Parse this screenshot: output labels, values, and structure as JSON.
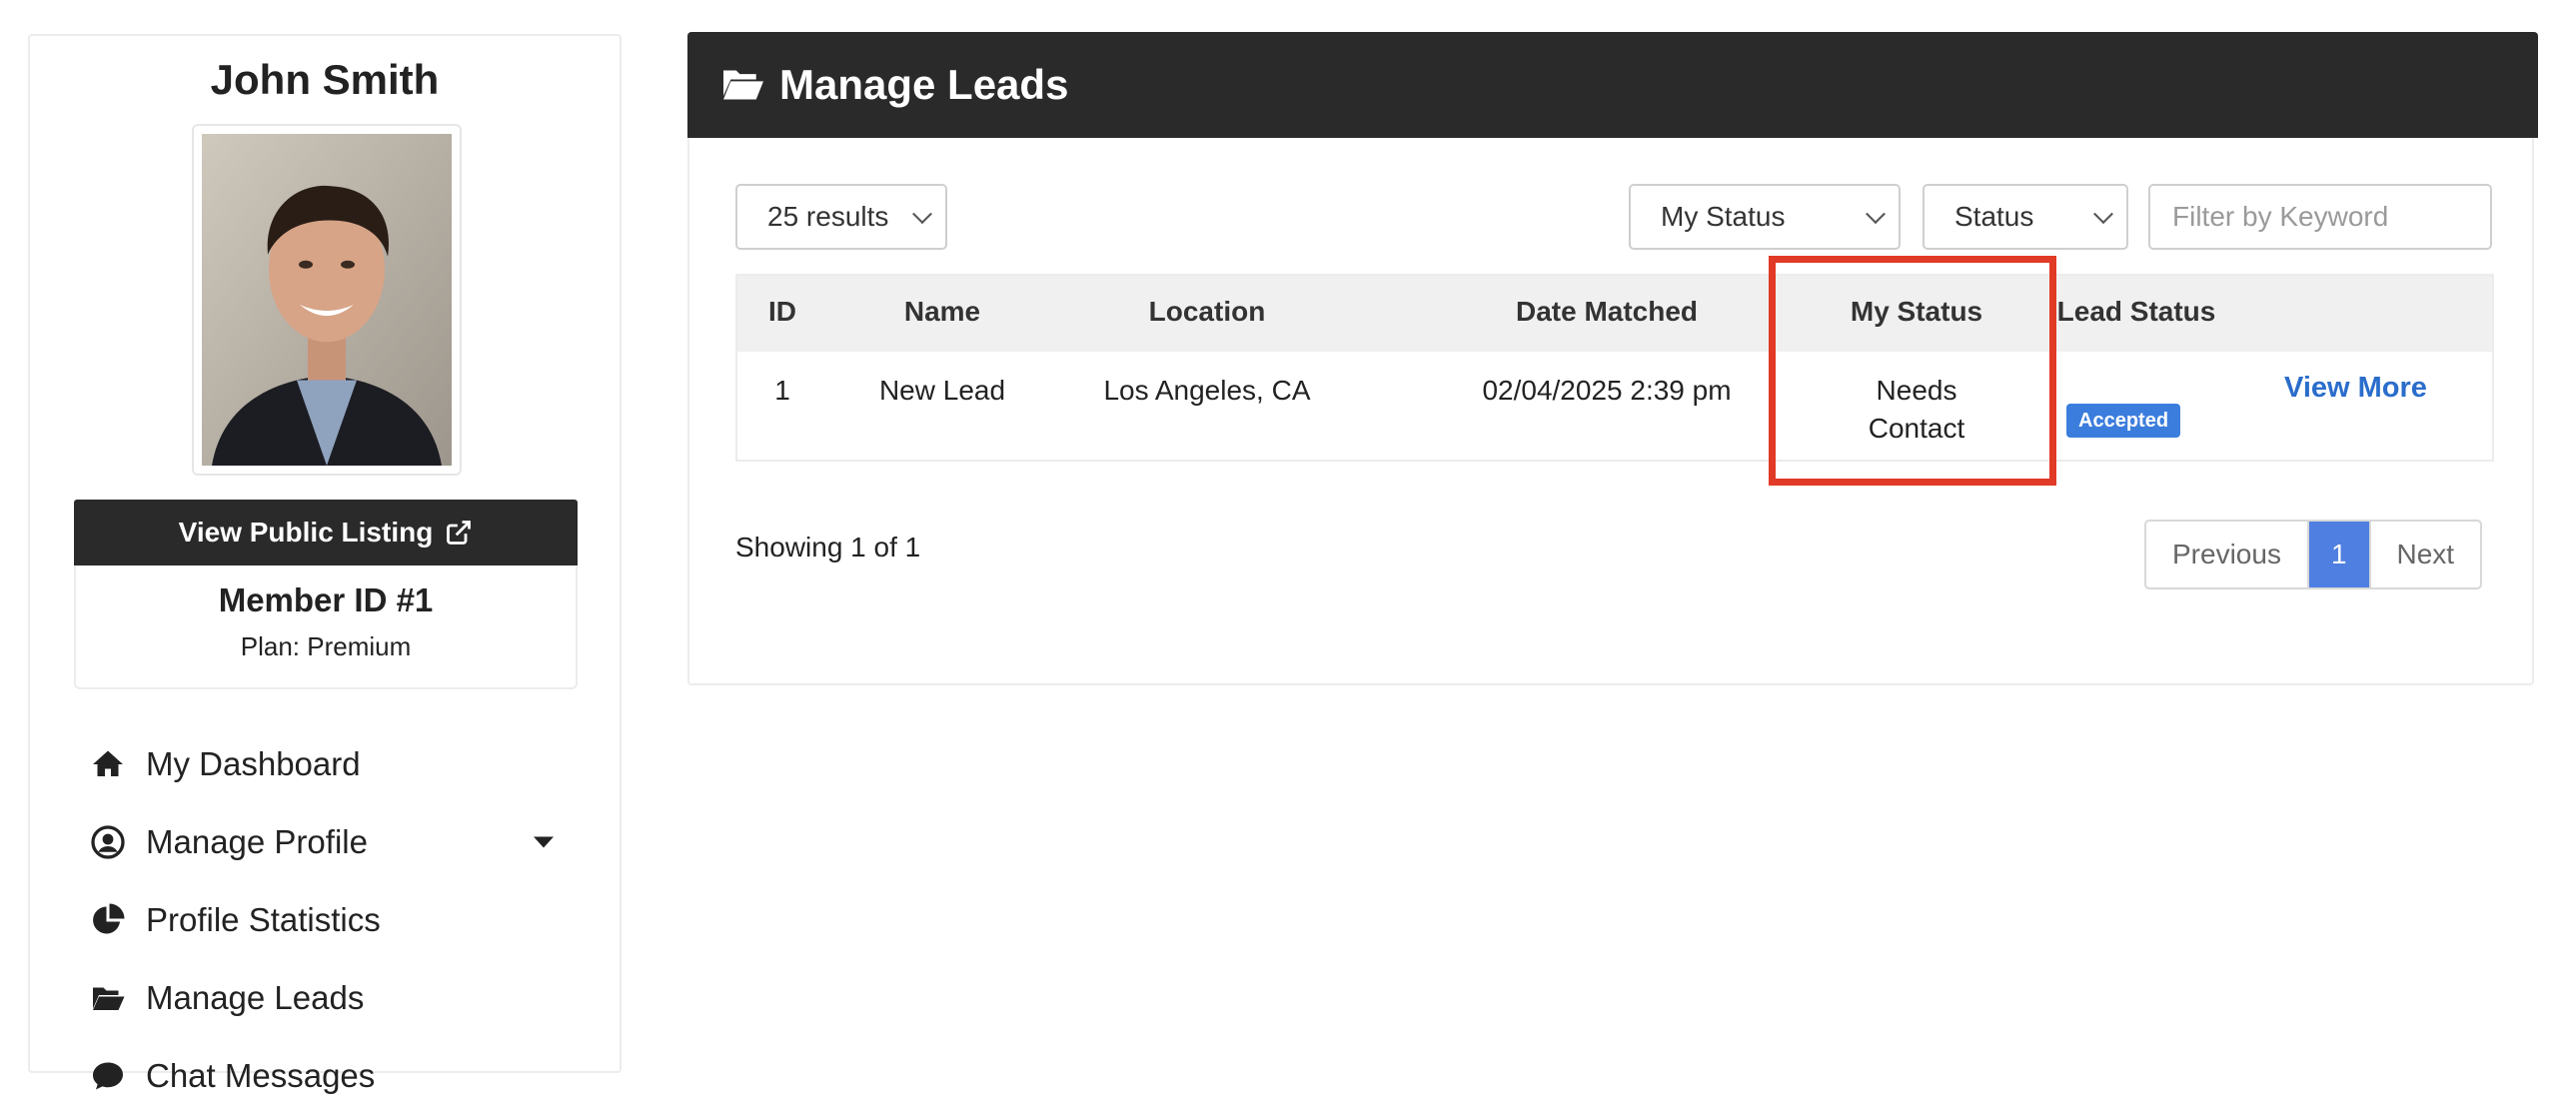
{
  "profile": {
    "name": "John Smith",
    "public_listing_label": "View Public Listing",
    "member_id": "Member ID #1",
    "plan": "Plan: Premium"
  },
  "nav": {
    "items": [
      {
        "label": "My Dashboard",
        "icon": "home-icon"
      },
      {
        "label": "Manage Profile",
        "icon": "user-circle-icon"
      },
      {
        "label": "Profile Statistics",
        "icon": "pie-chart-icon"
      },
      {
        "label": "Manage Leads",
        "icon": "folder-open-icon"
      },
      {
        "label": "Chat Messages",
        "icon": "chat-icon"
      }
    ]
  },
  "main": {
    "title": "Manage Leads",
    "results_select": "25 results",
    "my_status_select": "My Status",
    "status_select": "Status",
    "keyword_placeholder": "Filter by Keyword"
  },
  "table": {
    "headers": [
      "ID",
      "Name",
      "Location",
      "Date Matched",
      "My Status",
      "Lead Status"
    ],
    "rows": [
      {
        "id": "1",
        "name": "New Lead",
        "location": "Los Angeles, CA",
        "date_matched": "02/04/2025 2:39 pm",
        "my_status_line1": "Needs",
        "my_status_line2": "Contact",
        "lead_status": "Accepted",
        "action": "View More"
      }
    ]
  },
  "pagination": {
    "showing": "Showing 1 of 1",
    "previous": "Previous",
    "current": "1",
    "next": "Next"
  },
  "colors": {
    "header_bg": "#2a2a2a",
    "badge": "#3b7ddd",
    "link": "#2a6dcb",
    "highlight": "#e13a26",
    "page_active": "#4f7fe0"
  }
}
